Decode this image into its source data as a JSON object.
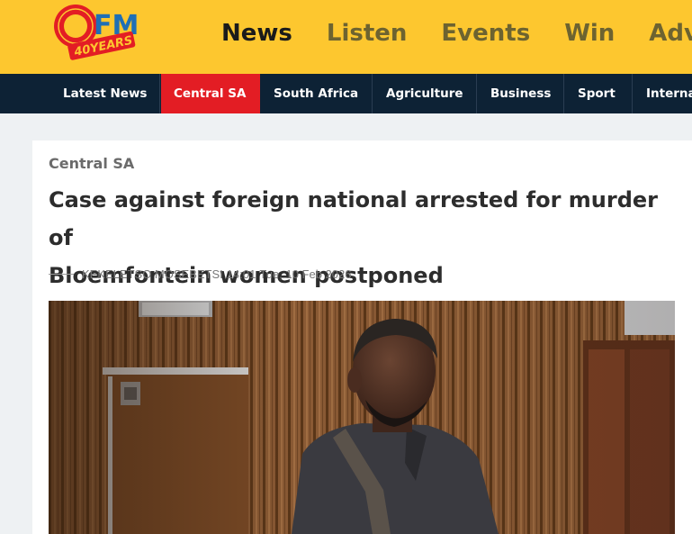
{
  "logo": {
    "main": "OFM",
    "tagline": "40YEARS"
  },
  "main_nav": [
    {
      "label": "News",
      "active": true
    },
    {
      "label": "Listen",
      "active": false
    },
    {
      "label": "Events",
      "active": false
    },
    {
      "label": "Win",
      "active": false
    },
    {
      "label": "Adver",
      "active": false
    }
  ],
  "sub_nav": [
    {
      "label": "Latest News",
      "active": false
    },
    {
      "label": "Central SA",
      "active": true
    },
    {
      "label": "South Africa",
      "active": false
    },
    {
      "label": "Agriculture",
      "active": false
    },
    {
      "label": "Business",
      "active": false
    },
    {
      "label": "Sport",
      "active": false
    },
    {
      "label": "Interna",
      "active": false
    }
  ],
  "article": {
    "section": "Central SA",
    "headline_line1": "Case against foreign national arrested for murder of",
    "headline_line2": "Bloemfontein women postponed",
    "author": "KEKELETSO MOSEBETSI",
    "time": "14:01",
    "date": "Tue, 10 Feb 2026"
  },
  "colors": {
    "header_yellow": "#fdc72f",
    "nav_dark": "#0d2235",
    "active_red": "#e31d24"
  }
}
